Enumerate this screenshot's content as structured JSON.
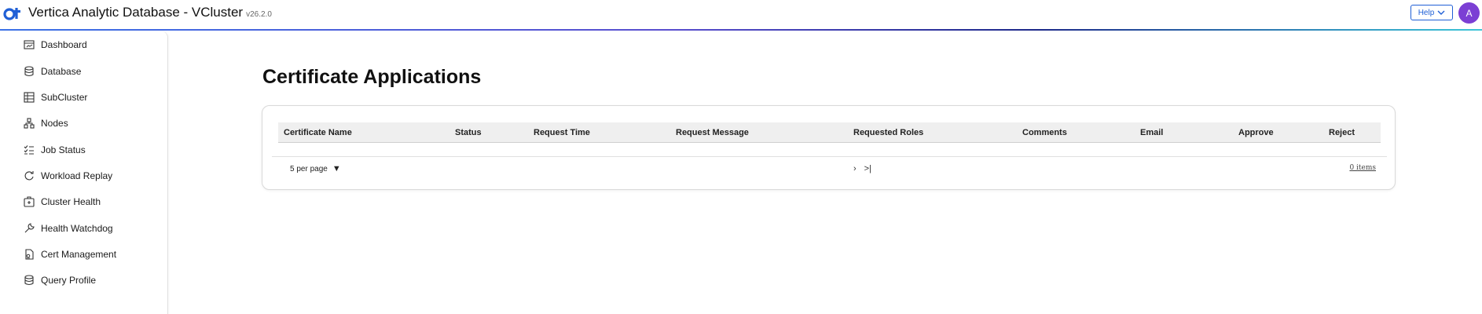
{
  "header": {
    "title": "Vertica Analytic Database - VCluster",
    "version": "v26.2.0",
    "help_label": "Help",
    "avatar_initial": "A"
  },
  "sidebar": {
    "items": [
      {
        "label": "Dashboard",
        "icon": "dashboard-icon"
      },
      {
        "label": "Database",
        "icon": "database-icon"
      },
      {
        "label": "SubCluster",
        "icon": "subcluster-icon"
      },
      {
        "label": "Nodes",
        "icon": "nodes-icon"
      },
      {
        "label": "Job Status",
        "icon": "job-status-icon"
      },
      {
        "label": "Workload Replay",
        "icon": "replay-icon"
      },
      {
        "label": "Cluster Health",
        "icon": "cluster-health-icon"
      },
      {
        "label": "Health Watchdog",
        "icon": "wrench-icon"
      },
      {
        "label": "Cert Management",
        "icon": "certificate-icon"
      },
      {
        "label": "Query Profile",
        "icon": "database-icon"
      }
    ]
  },
  "main": {
    "title": "Certificate Applications",
    "table": {
      "columns": [
        "Certificate Name",
        "Status",
        "Request Time",
        "Request Message",
        "Requested Roles",
        "Comments",
        "Email",
        "Approve",
        "Reject"
      ],
      "rows": []
    },
    "pagination": {
      "per_page": "5 per page",
      "next": "›",
      "last": ">|",
      "items": "0 items"
    }
  },
  "colors": {
    "accent": "#1f5fd6",
    "avatar": "#7b3fd4",
    "logo": "#1f5fd6"
  }
}
